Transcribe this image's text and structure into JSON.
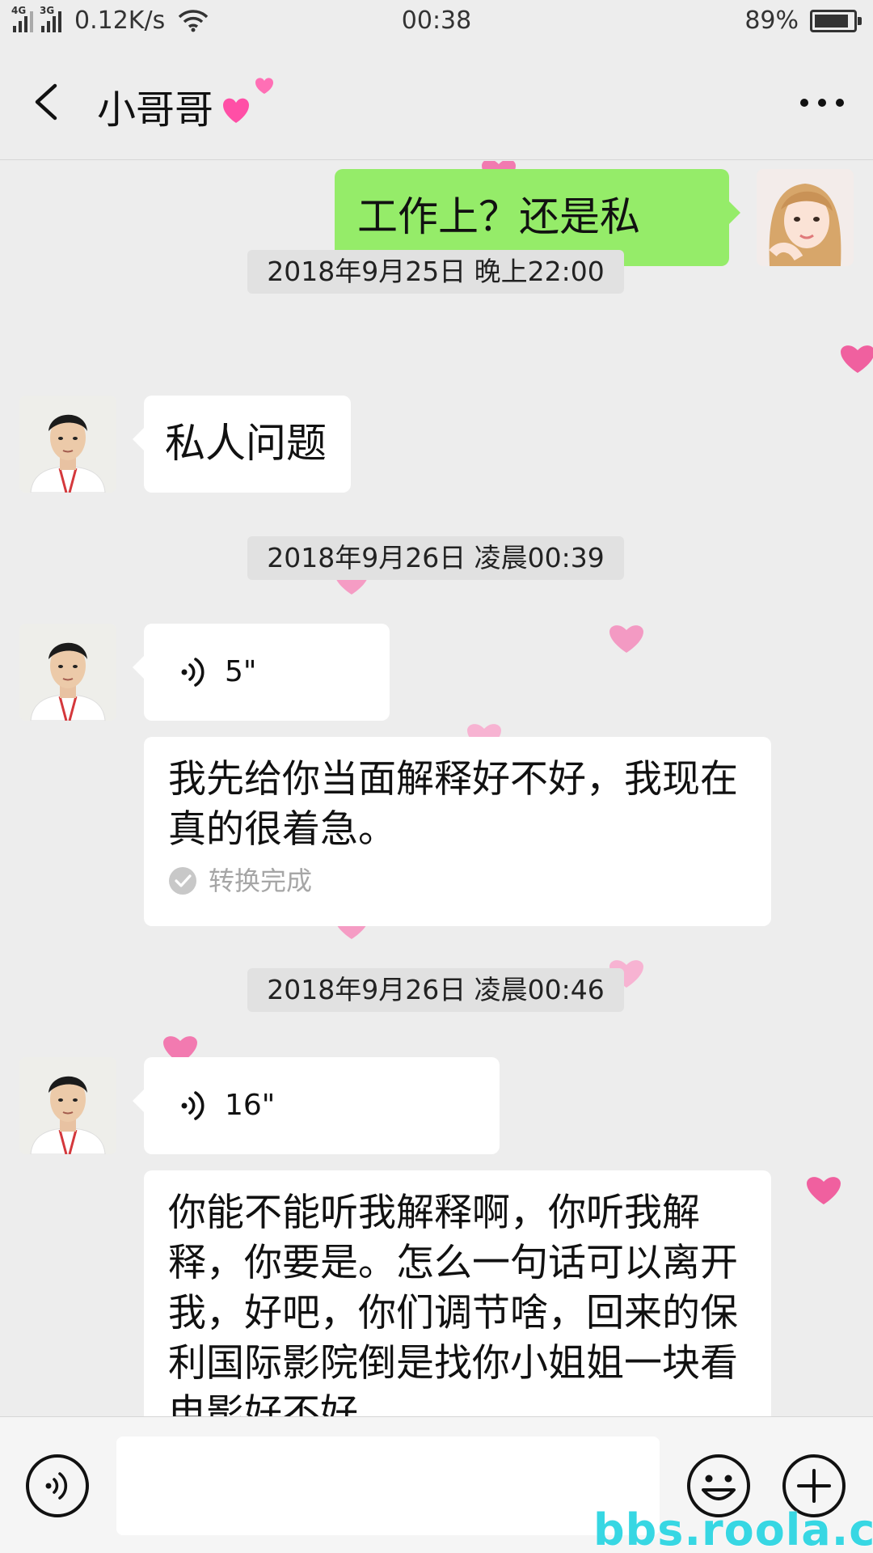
{
  "status_bar": {
    "signal1_label": "4G",
    "signal2_label": "3G",
    "net_speed": "0.12K/s",
    "time": "00:38",
    "battery": "89%",
    "battery_level": 0.89
  },
  "header": {
    "title": "小哥哥",
    "back_icon": "chevron-left-icon",
    "more_icon": "more-dots-icon"
  },
  "messages": {
    "m1": {
      "sender": "self",
      "text": "工作上？还是私人？"
    },
    "ts1": "2018年9月25日 晚上22:00",
    "m2": {
      "sender": "contact",
      "text": "私人问题"
    },
    "ts2": "2018年9月26日 凌晨00:39",
    "m3": {
      "sender": "contact",
      "duration": "5\"",
      "transcript": "我先给你当面解释好不好，我现在真的很着急。",
      "status": "转换完成"
    },
    "ts3": "2018年9月26日 凌晨00:46",
    "m4": {
      "sender": "contact",
      "duration": "16\"",
      "transcript": "你能不能听我解释啊，你听我解释，你要是。怎么一句话可以离开我，好吧，你们调节啥，回来的保利国际影院倒是找你小姐姐一块看电影好不好。"
    }
  },
  "input_bar": {
    "placeholder": "",
    "voice_icon": "voice-mode-icon",
    "emoji_icon": "emoji-icon",
    "plus_icon": "plus-icon"
  },
  "watermark": "bbs.roola.cn",
  "colors": {
    "self_bubble": "#95ec69",
    "background": "#ededed",
    "heart": "#f27ab0"
  }
}
